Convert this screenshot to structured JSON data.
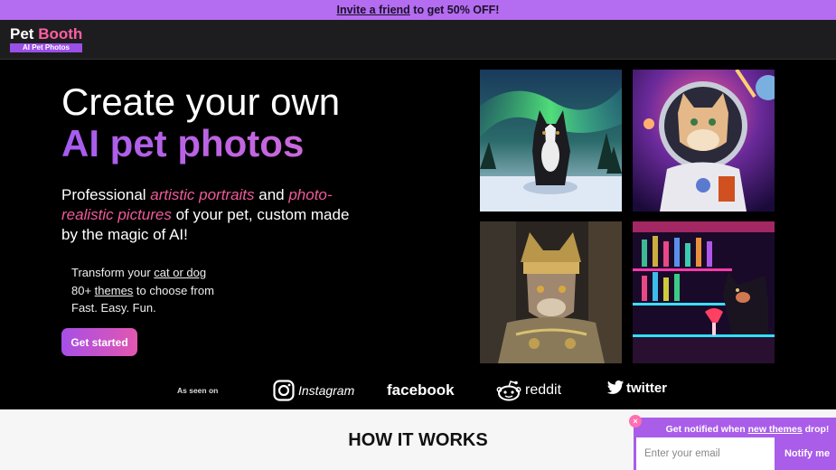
{
  "promo": {
    "link_text": "Invite a friend",
    "rest_text": " to get 50% OFF!"
  },
  "nav": {
    "logo_pet": "Pet",
    "logo_booth": "Booth",
    "logo_sub": "AI Pet Photos"
  },
  "hero": {
    "title_line1": "Create your own",
    "title_line2": "AI pet photos",
    "desc_part1": "Professional ",
    "desc_em1": "artistic portraits",
    "desc_part2": " and ",
    "desc_em2": "photo-realistic pictures",
    "desc_part3": " of your pet, custom made by the magic of AI!",
    "features": [
      {
        "prefix": "Transform your ",
        "link": "cat or dog",
        "suffix": ""
      },
      {
        "prefix": "80+ ",
        "link": "themes",
        "suffix": " to choose from"
      },
      {
        "prefix": "Fast. Easy. Fun.",
        "link": "",
        "suffix": ""
      }
    ],
    "cta_label": "Get started"
  },
  "gallery": {
    "images": [
      {
        "icon": "dog-aurora-photo"
      },
      {
        "icon": "cat-astronaut-photo"
      },
      {
        "icon": "cat-knight-photo"
      },
      {
        "icon": "dog-neon-bar-photo"
      }
    ]
  },
  "seen_on": {
    "label": "As seen on",
    "brands": [
      "Instagram",
      "facebook",
      "reddit",
      "twitter"
    ]
  },
  "how_it_works": {
    "title": "HOW IT WORKS"
  },
  "notify": {
    "close": "×",
    "title_prefix": "Get notified when ",
    "title_link": "new themes",
    "title_suffix": " drop!",
    "email_placeholder": "Enter your email",
    "button_label": "Notify me"
  },
  "colors": {
    "promo": "#b46cf0",
    "accent_pink": "#f05a9a",
    "accent_purple": "#a55cf0",
    "nav_bg": "#1d1d1f"
  }
}
